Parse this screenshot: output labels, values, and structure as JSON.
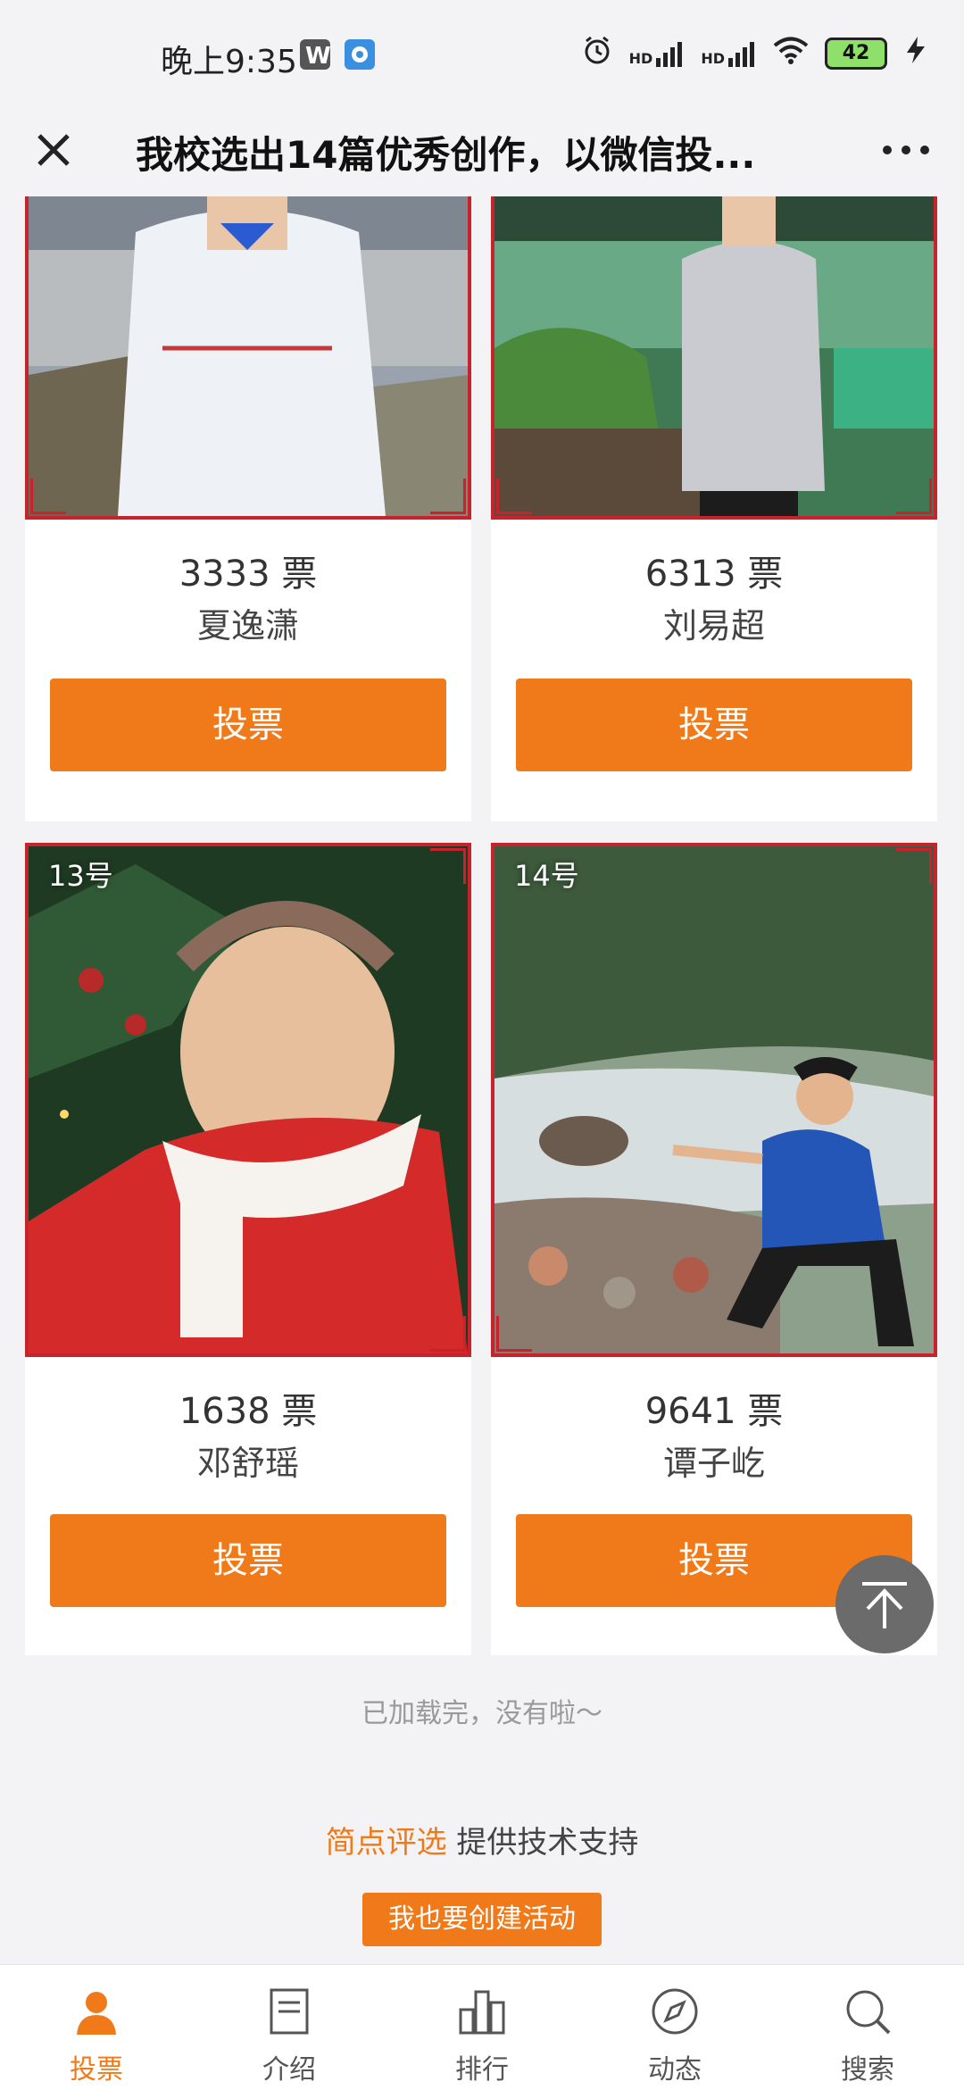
{
  "status_bar": {
    "time": "晚上9:35",
    "icons": [
      "wps-icon",
      "browser-icon",
      "alarm-icon",
      "signal-hd-icon",
      "signal-hd-icon",
      "wifi-icon",
      "battery-icon",
      "charging-icon"
    ],
    "hd1": "HD",
    "hd2": "HD",
    "battery_level": "42"
  },
  "nav": {
    "title": "我校选出14篇优秀创作，以微信投...",
    "close_icon": "close-icon",
    "more_icon": "more-icon"
  },
  "cards": [
    {
      "badge": "",
      "votes": "3333 票",
      "name": "夏逸潇",
      "button": "投票"
    },
    {
      "badge": "",
      "votes": "6313 票",
      "name": "刘易超",
      "button": "投票"
    },
    {
      "badge": "13号",
      "votes": "1638 票",
      "name": "邓舒瑶",
      "button": "投票"
    },
    {
      "badge": "14号",
      "votes": "9641 票",
      "name": "谭子屹",
      "button": "投票"
    }
  ],
  "footer": {
    "loaded_text": "已加载完，没有啦～",
    "brand": "简点评选",
    "support_text": " 提供技术支持",
    "create_button": "我也要创建活动"
  },
  "tabs": [
    {
      "label": "投票",
      "icon": "person-icon",
      "active": true
    },
    {
      "label": "介绍",
      "icon": "document-icon",
      "active": false
    },
    {
      "label": "排行",
      "icon": "bar-chart-icon",
      "active": false
    },
    {
      "label": "动态",
      "icon": "compass-icon",
      "active": false
    },
    {
      "label": "搜索",
      "icon": "search-icon",
      "active": false
    }
  ],
  "colors": {
    "accent": "#f07a1a",
    "frame": "#c8232c",
    "background": "#f3f3f5"
  }
}
